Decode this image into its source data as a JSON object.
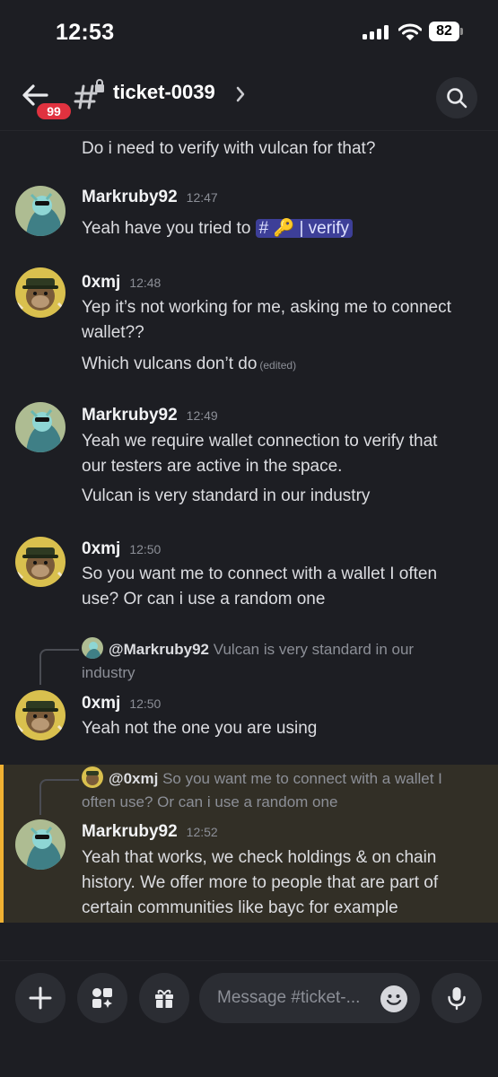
{
  "status": {
    "time": "12:53",
    "battery": "82"
  },
  "header": {
    "badge": "99",
    "channel": "ticket-0039"
  },
  "messages": {
    "m0": {
      "text": "Do i need to verify with vulcan for that?"
    },
    "m1": {
      "author": "Markruby92",
      "time": "12:47",
      "text": "Yeah have you tried to",
      "mention": "# 🔑 | verify"
    },
    "m2": {
      "author": "0xmj",
      "time": "12:48",
      "line1": "Yep it’s not working for me, asking me to connect",
      "line2": "wallet??",
      "line3": "Which vulcans don’t do",
      "edited": "(edited)"
    },
    "m3": {
      "author": "Markruby92",
      "time": "12:49",
      "line1": "Yeah we require wallet connection to verify that",
      "line2": "our testers are active in the space.",
      "line3": "Vulcan is very standard in our industry"
    },
    "m4": {
      "author": "0xmj",
      "time": "12:50",
      "line1": "So you want me to connect with a wallet I often",
      "line2": "use? Or can i use a random one"
    },
    "m5": {
      "reply_name": "@Markruby92",
      "reply_text1": "Vulcan is very standard in our",
      "reply_text2": "industry",
      "author": "0xmj",
      "time": "12:50",
      "text": "Yeah not the one you are using"
    },
    "m6": {
      "reply_name": "@0xmj",
      "reply_text1": "So you want me to connect with a wallet I",
      "reply_text2": "often use? Or can i use a random one",
      "author": "Markruby92",
      "time": "12:52",
      "line1": "Yeah that works, we check holdings & on chain",
      "line2": "history. We offer more to people that are part of",
      "line3": "certain communities like bayc for example"
    }
  },
  "composer": {
    "placeholder": "Message #ticket-..."
  },
  "colors": {
    "background": "#1d1e23",
    "mention": "#3d3f98",
    "highlight": "#322f26",
    "highlight_bar": "#f0b132",
    "badge": "#e0323f"
  },
  "icons": [
    "back-arrow-icon",
    "locked-channel-icon",
    "chevron-right-icon",
    "search-icon",
    "plus-icon",
    "apps-icon",
    "gift-icon",
    "emoji-icon",
    "microphone-icon"
  ]
}
